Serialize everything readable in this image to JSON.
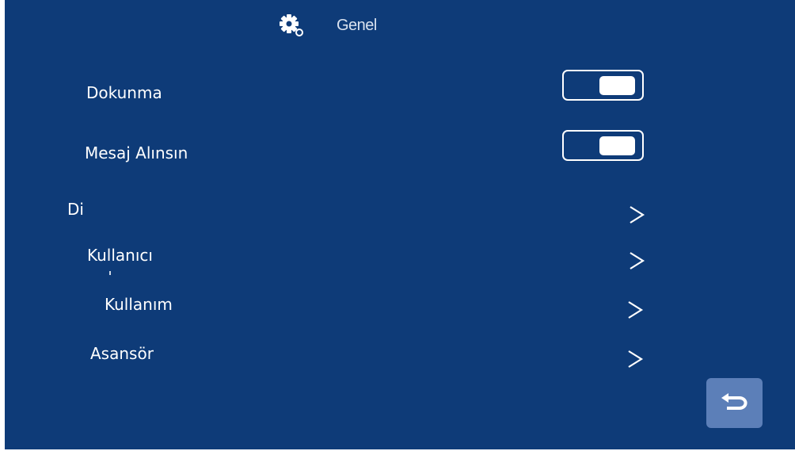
{
  "header": {
    "icon": "gear-icon",
    "title": "Genel"
  },
  "settings": {
    "touch": {
      "label": "Dokunma",
      "control": "toggle",
      "on": true
    },
    "message": {
      "label": "Mesaj Alınsın",
      "control": "toggle",
      "on": true
    },
    "language": {
      "label": "Di",
      "control": "chevron-right-icon"
    },
    "user": {
      "label": "Kullanıcı",
      "control": "chevron-right-icon"
    },
    "usage": {
      "label": "Kullanım",
      "control": "chevron-right-icon"
    },
    "elevator": {
      "label": "Asansör",
      "control": "chevron-right-icon"
    }
  },
  "footer": {
    "back_icon": "back-arrow-icon"
  },
  "colors": {
    "background": "#0e3b78",
    "text": "#ffffff",
    "back_button": "#5c7fb8"
  }
}
